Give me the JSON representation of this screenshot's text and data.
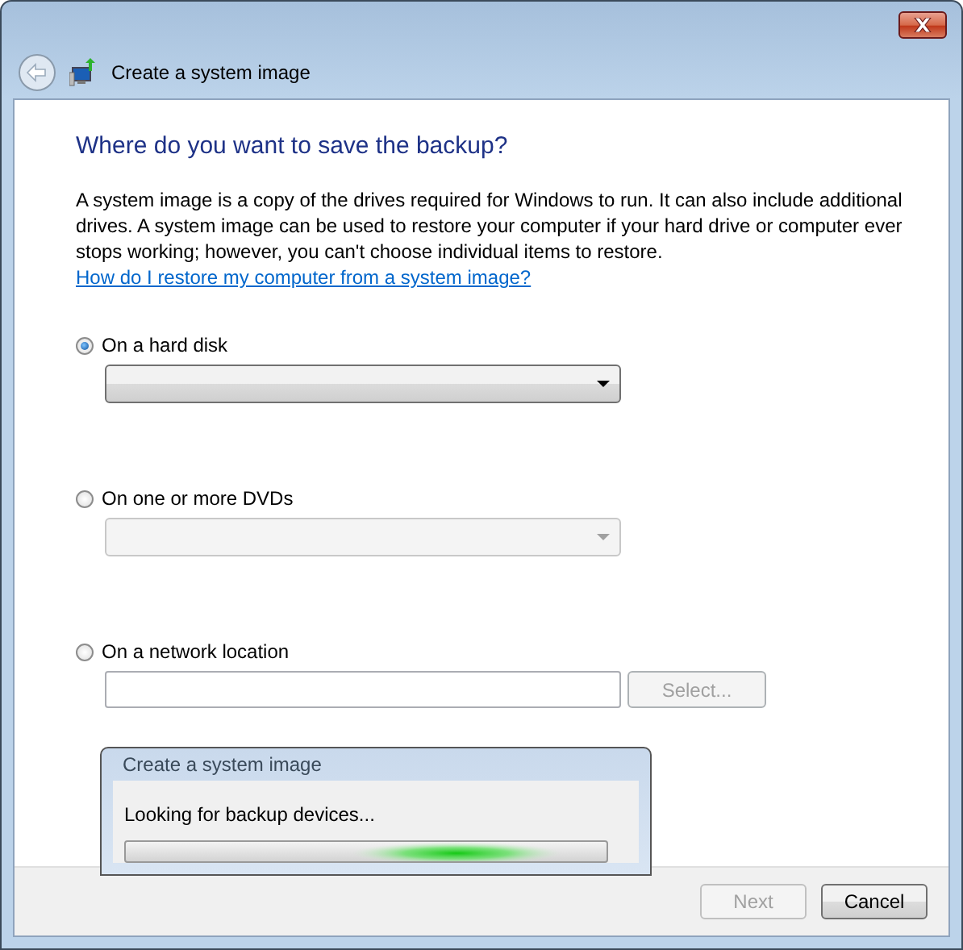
{
  "window": {
    "title": "Create a system image"
  },
  "heading": "Where do you want to save the backup?",
  "description": "A system image is a copy of the drives required for Windows to run. It can also include additional drives. A system image can be used to restore your computer if your hard drive or computer ever stops working; however, you can't choose individual items to restore.",
  "help_link": "How do I restore my computer from a system image?",
  "options": [
    {
      "kind": "dropdown",
      "label": "On a hard disk",
      "selected": true,
      "disabled": false
    },
    {
      "kind": "dropdown",
      "label": "On one or more DVDs",
      "selected": false,
      "disabled": true
    },
    {
      "kind": "path",
      "label": "On a network location",
      "selected": false,
      "button": {
        "label": "Select...",
        "disabled": true
      }
    }
  ],
  "buttons": [
    {
      "label": "Next",
      "disabled": true
    },
    {
      "label": "Cancel",
      "disabled": false
    }
  ],
  "progress_dialog": {
    "title": "Create a system image",
    "message": "Looking for backup devices...",
    "indeterminate": true
  }
}
